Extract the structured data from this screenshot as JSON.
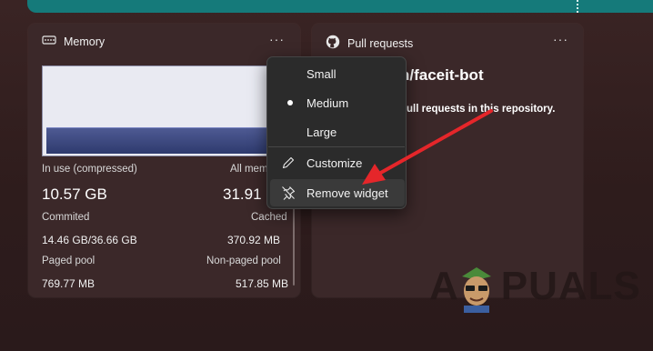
{
  "memory_widget": {
    "title": "Memory",
    "icon": "memory-chip-icon",
    "more_icon": "···",
    "usage_fraction": 0.3,
    "in_use_label": "In use (compressed)",
    "in_use_value": "10.57 GB",
    "all_memory_label": "All memo",
    "all_memory_value": "31.91",
    "committed_label": "Commited",
    "committed_value": "14.46 GB/36.66 GB",
    "cached_label": "Cached",
    "cached_value": "370.92 MB",
    "paged_pool_label": "Paged pool",
    "paged_pool_value": "769.77 MB",
    "non_paged_pool_label": "Non-paged pool",
    "non_paged_pool_value": "517.85 MB"
  },
  "pr_widget": {
    "title": "Pull requests",
    "icon": "github-icon",
    "more_icon": "···",
    "repo_partial": "n/faceit-bot",
    "message_partial": "pull requests in this repository."
  },
  "context_menu": {
    "items": [
      {
        "label": "Small",
        "icon": ""
      },
      {
        "label": "Medium",
        "icon": "bullet-icon"
      },
      {
        "label": "Large",
        "icon": ""
      },
      {
        "label": "Customize",
        "icon": "pencil-icon"
      },
      {
        "label": "Remove widget",
        "icon": "unpin-icon"
      }
    ]
  },
  "annotation": {
    "arrow_color": "#e5262a"
  },
  "colors": {
    "banner": "#157a7a",
    "widget_bg": "#3b2829",
    "menu_bg": "#2b2b2b"
  },
  "watermark": {
    "text_left": "A",
    "text_right": "PUALS"
  }
}
